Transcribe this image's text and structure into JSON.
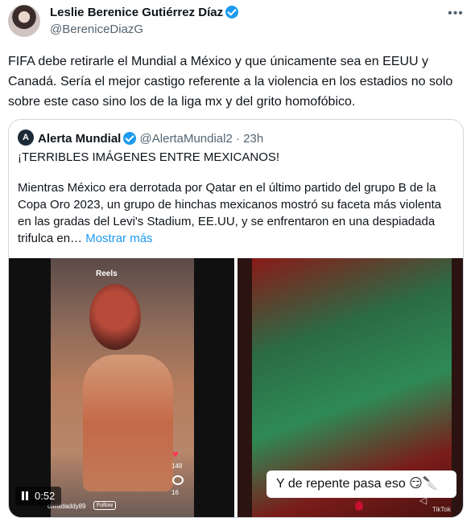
{
  "author": {
    "name": "Leslie Berenice Gutiérrez Díaz",
    "handle": "@BereniceDiazG"
  },
  "tweet_text": "FIFA debe retirarle el Mundial a México y que únicamente sea en EEUU y Canadá. Sería el mejor castigo referente a la violencia en los estadios no solo sobre este caso sino los de la liga mx y del grito homofóbico.",
  "quote": {
    "name": "Alerta Mundial",
    "handle": "@AlertaMundial2",
    "time": "· 23h",
    "headline": "¡TERRIBLES IMÁGENES ENTRE MEXICANOS!",
    "body": "Mientras México era derrotada por Qatar en el último partido del grupo B de la Copa Oro 2023, un grupo de hinchas mexicanos mostró su faceta más violenta en las gradas del Levi's Stadium, EE.UU, y se enfrentaron en una despiadada trifulca en…",
    "show_more": "Mostrar más"
  },
  "media": {
    "duration": "0:52",
    "reels_label": "Reels",
    "like_count": "148",
    "comment_count": "16",
    "username": "chrisdaddy89",
    "follow_label": "Follow",
    "caption": "Y de repente pasa eso 😏🔪",
    "watermark": "TikTok"
  },
  "icons": {
    "verified": "verified-badge-icon",
    "more": "more-options-icon",
    "pause": "pause-icon"
  },
  "colors": {
    "accent": "#1d9bf0",
    "text": "#0f1419",
    "muted": "#536471",
    "border": "#cfd9de"
  }
}
